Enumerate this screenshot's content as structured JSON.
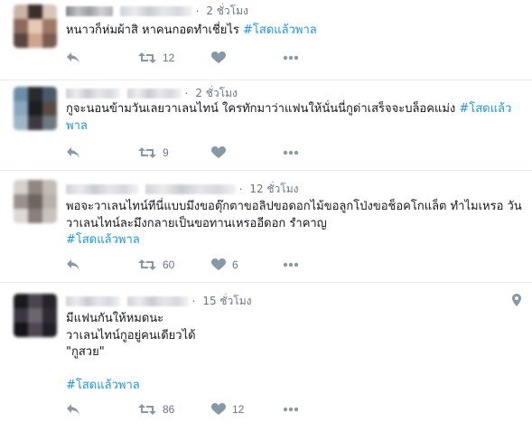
{
  "colors": {
    "hashtag": "#1b95e0",
    "secondary": "#657786",
    "divider": "#e6ecf0"
  },
  "icons": [
    "reply-icon",
    "retweet-icon",
    "like-icon",
    "more-icon",
    "location-pin-icon"
  ],
  "tweets": [
    {
      "time": "2 ชั่วโมง",
      "text": "หนาวก็ห่มผ้าสิ หาคนกอดทำเชี่ยไร ",
      "hashtag": "#โสดแล้วพาล",
      "retweets": "12",
      "likes": ""
    },
    {
      "time": "2 ชั่วโมง",
      "text": "กูจะนอนข้ามวันเลยวาเลนไทน์ ใครทักมาว่าแฟนให้นั่นนี่กูด่าเสร็จจะบล็อคแม่ง ",
      "hashtag": "#โสดแล้วพาล",
      "retweets": "9",
      "likes": ""
    },
    {
      "time": "12 ชั่วโมง",
      "text": "พอจะวาเลนไทน์ทีนี่แบบมึงขอตุ๊กตาขอลิปขอดอกไม้ขอลูกโป่งขอช็อคโกแล็ต ทำไมเหรอ วันวาเลนไทน์ละมึงกลายเป็นขอทานเหรออีดอก รำคาญ\n",
      "hashtag": "#โสดแล้วพาล",
      "retweets": "60",
      "likes": "6"
    },
    {
      "time": "15 ชั่วโมง",
      "text": "มีแฟนกันให้หมดนะ\nวาเลนไทน์กูอยู่คนเดียวได้\n\"กูสวย\"\n\n",
      "hashtag": "#โสดแล้วพาล",
      "retweets": "86",
      "likes": "12"
    }
  ]
}
